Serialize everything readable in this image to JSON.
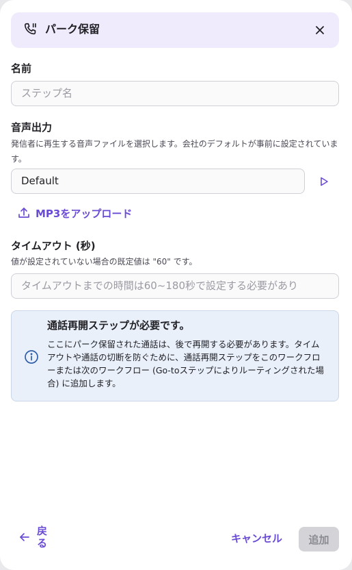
{
  "header": {
    "title": "パーク保留",
    "icon": "phone-hold-icon"
  },
  "name_field": {
    "label": "名前",
    "placeholder": "ステップ名",
    "value": ""
  },
  "audio_output": {
    "label": "音声出力",
    "help": "発信者に再生する音声ファイルを選択します。会社のデフォルトが事前に設定されています。",
    "selected": "Default",
    "upload_label": "MP3をアップロード"
  },
  "timeout": {
    "label": "タイムアウト (秒)",
    "help": "値が設定されていない場合の既定値は \"60\" です。",
    "placeholder": "タイムアウトまでの時間は60~180秒で設定する必要があり",
    "value": ""
  },
  "info": {
    "title": "通話再開ステップが必要です。",
    "body": "ここにパーク保留された通話は、後で再開する必要があります。タイムアウトや通話の切断を防ぐために、通話再開ステップをこのワークフローまたは次のワークフロー (Go-toステップによりルーティングされた場合) に追加します。"
  },
  "footer": {
    "back_label": "戻る",
    "cancel_label": "キャンセル",
    "add_label": "追加"
  },
  "colors": {
    "accent": "#6a4bd4",
    "header_bg": "#efeafc",
    "info_bg": "#e9f0fa",
    "disabled_bg": "#d4d4d8"
  }
}
